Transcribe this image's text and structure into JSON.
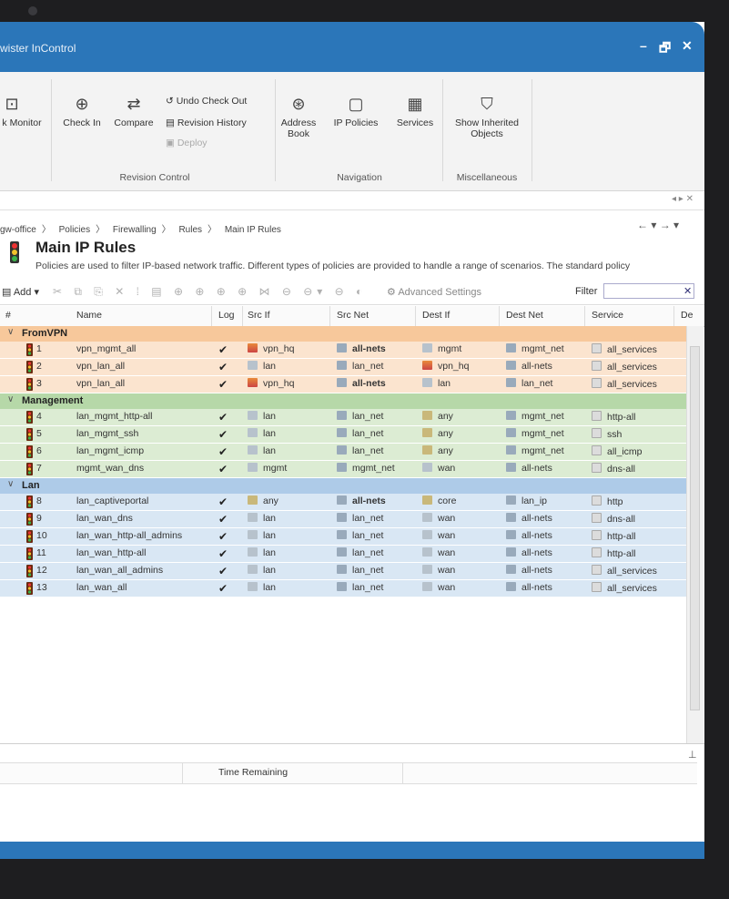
{
  "window": {
    "title": "wister InControl",
    "controls": {
      "minimize": "–",
      "restore": "🗗",
      "close": "✕"
    }
  },
  "ribbon": {
    "monitor_label": "k Monitor",
    "check_in": "Check In",
    "compare": "Compare",
    "undo_checkout": "Undo Check Out",
    "revision_history": "Revision History",
    "deploy": "Deploy",
    "address_book": "Address\nBook",
    "ip_policies": "IP Policies",
    "services": "Services",
    "show_inherited": "Show Inherited\nObjects",
    "groups": {
      "revision_control": "Revision Control",
      "navigation": "Navigation",
      "miscellaneous": "Miscellaneous"
    }
  },
  "breadcrumb": [
    "gw-office",
    "Policies",
    "Firewalling",
    "Rules",
    "Main IP Rules"
  ],
  "page": {
    "title": "Main IP Rules",
    "description": "Policies are used to filter IP-based network traffic. Different types of policies are provided to handle a range of scenarios. The standard policy"
  },
  "toolbar": {
    "add": "Add",
    "advanced": "Advanced Settings",
    "filter_label": "Filter",
    "filter_value": ""
  },
  "columns": [
    "#",
    "Name",
    "Log",
    "Src If",
    "Src Net",
    "Dest If",
    "Dest Net",
    "Service",
    "De"
  ],
  "groups": [
    {
      "name": "FromVPN",
      "color": "#f7c89b",
      "row_color": "#fbe4cf",
      "rows": [
        {
          "num": "1",
          "name": "vpn_mgmt_all",
          "log": true,
          "src_if": "vpn_hq",
          "src_net": "all-nets",
          "dest_if": "mgmt",
          "dest_net": "mgmt_net",
          "service": "all_services"
        },
        {
          "num": "2",
          "name": "vpn_lan_all",
          "log": true,
          "src_if": "lan",
          "src_net": "lan_net",
          "dest_if": "vpn_hq",
          "dest_net": "all-nets",
          "service": "all_services"
        },
        {
          "num": "3",
          "name": "vpn_lan_all",
          "log": true,
          "src_if": "vpn_hq",
          "src_net": "all-nets",
          "dest_if": "lan",
          "dest_net": "lan_net",
          "service": "all_services"
        }
      ]
    },
    {
      "name": "Management",
      "color": "#b6d8a8",
      "row_color": "#dcecd3",
      "rows": [
        {
          "num": "4",
          "name": "lan_mgmt_http-all",
          "log": true,
          "src_if": "lan",
          "src_net": "lan_net",
          "dest_if": "any",
          "dest_net": "mgmt_net",
          "service": "http-all"
        },
        {
          "num": "5",
          "name": "lan_mgmt_ssh",
          "log": true,
          "src_if": "lan",
          "src_net": "lan_net",
          "dest_if": "any",
          "dest_net": "mgmt_net",
          "service": "ssh"
        },
        {
          "num": "6",
          "name": "lan_mgmt_icmp",
          "log": true,
          "src_if": "lan",
          "src_net": "lan_net",
          "dest_if": "any",
          "dest_net": "mgmt_net",
          "service": "all_icmp"
        },
        {
          "num": "7",
          "name": "mgmt_wan_dns",
          "log": true,
          "src_if": "mgmt",
          "src_net": "mgmt_net",
          "dest_if": "wan",
          "dest_net": "all-nets",
          "service": "dns-all"
        }
      ]
    },
    {
      "name": "Lan",
      "color": "#aecbe8",
      "row_color": "#d9e7f4",
      "rows": [
        {
          "num": "8",
          "name": "lan_captiveportal",
          "log": true,
          "src_if": "any",
          "src_net": "all-nets",
          "dest_if": "core",
          "dest_net": "lan_ip",
          "service": "http"
        },
        {
          "num": "9",
          "name": "lan_wan_dns",
          "log": true,
          "src_if": "lan",
          "src_net": "lan_net",
          "dest_if": "wan",
          "dest_net": "all-nets",
          "service": "dns-all"
        },
        {
          "num": "10",
          "name": "lan_wan_http-all_admins",
          "log": true,
          "src_if": "lan",
          "src_net": "lan_net",
          "dest_if": "wan",
          "dest_net": "all-nets",
          "service": "http-all"
        },
        {
          "num": "11",
          "name": "lan_wan_http-all",
          "log": true,
          "src_if": "lan",
          "src_net": "lan_net",
          "dest_if": "wan",
          "dest_net": "all-nets",
          "service": "http-all"
        },
        {
          "num": "12",
          "name": "lan_wan_all_admins",
          "log": true,
          "src_if": "lan",
          "src_net": "lan_net",
          "dest_if": "wan",
          "dest_net": "all-nets",
          "service": "all_services"
        },
        {
          "num": "13",
          "name": "lan_wan_all",
          "log": true,
          "src_if": "lan",
          "src_net": "lan_net",
          "dest_if": "wan",
          "dest_net": "all-nets",
          "service": "all_services"
        }
      ]
    }
  ],
  "bottom_pane": {
    "time_remaining": "Time Remaining"
  },
  "colors": {
    "titlebar": "#2b76b9",
    "statusbar": "#2b76b9"
  }
}
